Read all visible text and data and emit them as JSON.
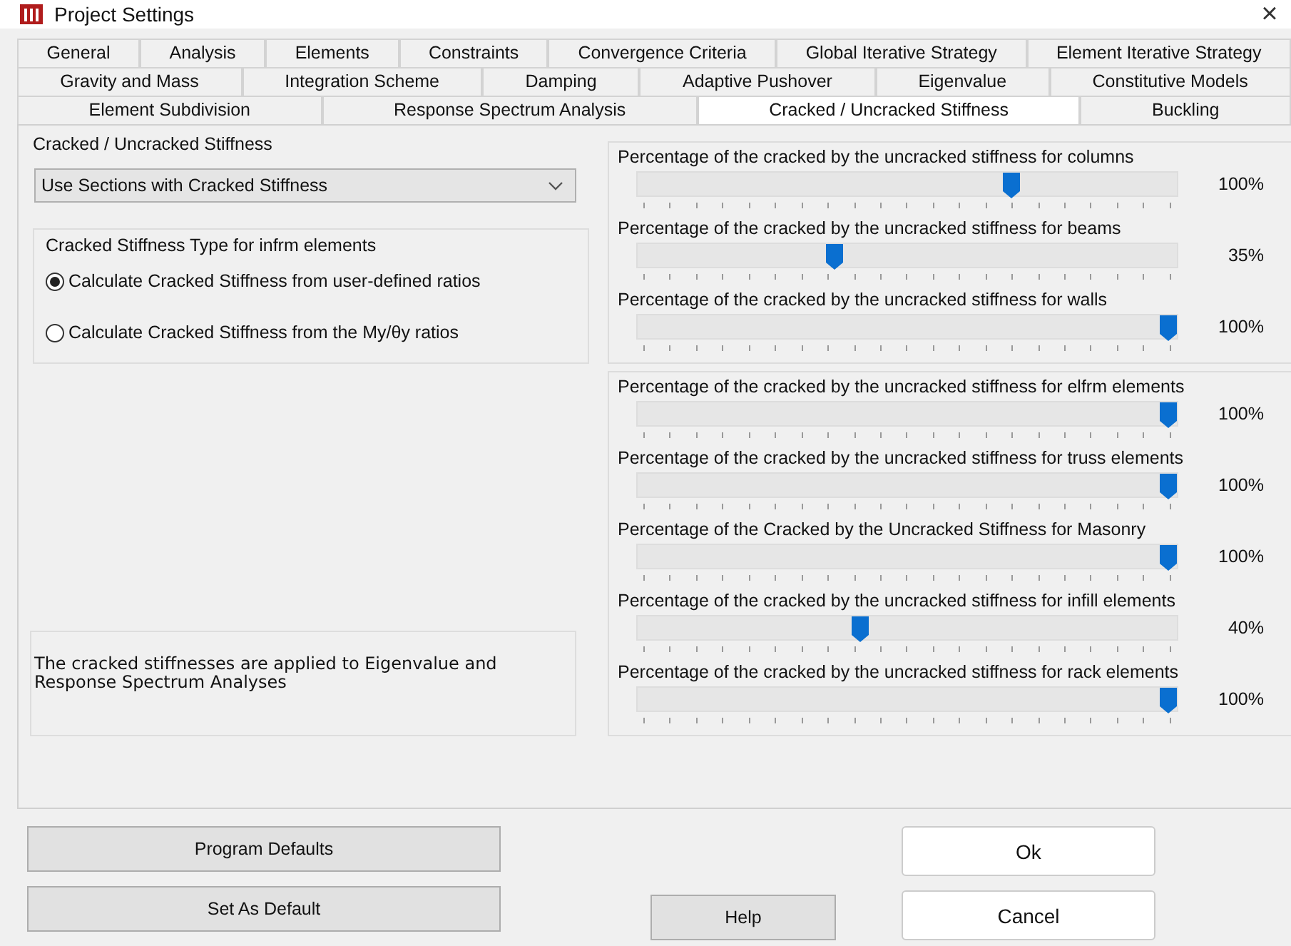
{
  "window": {
    "title": "Project Settings",
    "close": "×"
  },
  "tabs": [
    [
      {
        "label": "General",
        "selected": false
      },
      {
        "label": "Analysis",
        "selected": false
      },
      {
        "label": "Elements",
        "selected": false
      },
      {
        "label": "Constraints",
        "selected": false
      },
      {
        "label": "Convergence Criteria",
        "selected": false
      },
      {
        "label": "Global Iterative Strategy",
        "selected": false
      },
      {
        "label": "Element Iterative Strategy",
        "selected": false
      }
    ],
    [
      {
        "label": "Gravity and Mass",
        "selected": false
      },
      {
        "label": "Integration Scheme",
        "selected": false
      },
      {
        "label": "Damping",
        "selected": false
      },
      {
        "label": "Adaptive Pushover",
        "selected": false
      },
      {
        "label": "Eigenvalue",
        "selected": false
      },
      {
        "label": "Constitutive Models",
        "selected": false
      }
    ],
    [
      {
        "label": "Element Subdivision",
        "selected": false
      },
      {
        "label": "Response Spectrum Analysis",
        "selected": false
      },
      {
        "label": "Cracked / Uncracked Stiffness",
        "selected": true
      },
      {
        "label": "Buckling",
        "selected": false
      }
    ]
  ],
  "left": {
    "group_title": "Cracked / Uncracked Stiffness",
    "dropdown": {
      "value": "Use Sections with Cracked Stiffness"
    },
    "type_group": {
      "title": "Cracked Stiffness Type for infrm elements",
      "radios": [
        {
          "label": "Calculate Cracked Stiffness from user-defined ratios",
          "selected": true
        },
        {
          "label": "Calculate Cracked Stiffness from the My/θy ratios",
          "selected": false
        }
      ]
    },
    "note": "The cracked stiffnesses are applied to Eigenvalue and Response Spectrum Analyses"
  },
  "slider_groups": [
    [
      {
        "label": "Percentage of the cracked by the uncracked stiffness for columns",
        "level": 0.7,
        "reading": "100%"
      },
      {
        "label": "Percentage of the cracked by the uncracked stiffness for beams",
        "level": 0.36,
        "reading": "35%"
      },
      {
        "label": "Percentage of the cracked by the uncracked stiffness for walls",
        "level": 1,
        "reading": "100%"
      }
    ],
    [
      {
        "label": "Percentage of the cracked by the uncracked stiffness for elfrm elements",
        "level": 1,
        "reading": "100%"
      },
      {
        "label": "Percentage of the cracked by the uncracked stiffness for truss elements",
        "level": 1,
        "reading": "100%"
      },
      {
        "label": "Percentage of the Cracked by the Uncracked Stiffness for Masonry",
        "level": 1,
        "reading": "100%"
      },
      {
        "label": "Percentage of the cracked by the uncracked stiffness for infill elements",
        "level": 0.41,
        "reading": "40%"
      },
      {
        "label": "Percentage of the cracked by the uncracked stiffness for rack elements",
        "level": 1,
        "reading": "100%"
      }
    ]
  ],
  "buttons_left": [
    "Program Defaults",
    "Set As Default"
  ],
  "help_button": "Help",
  "buttons_right": [
    "Ok",
    "Cancel"
  ]
}
